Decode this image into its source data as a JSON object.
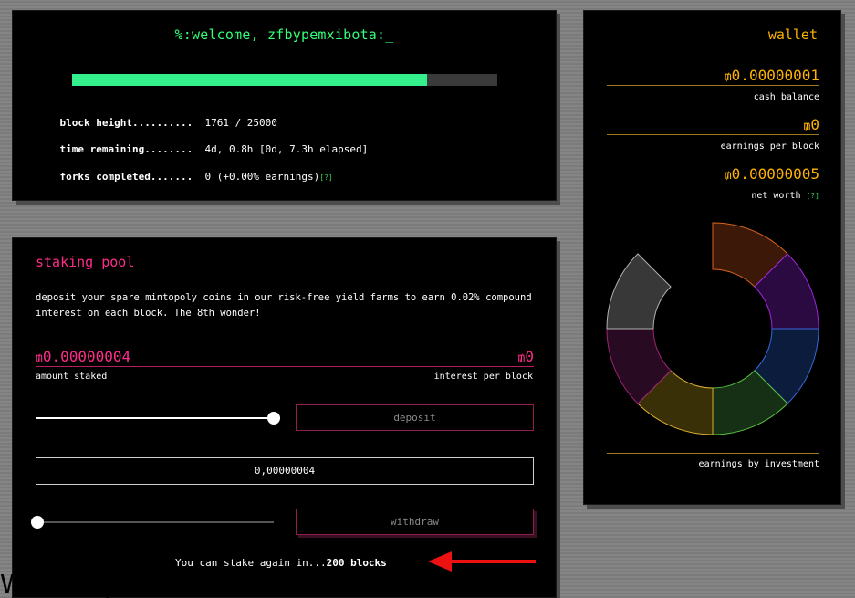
{
  "status": {
    "title": "%:welcome, zfbypemxibota:_",
    "progress_fraction": 0.835,
    "rows": [
      {
        "label": "block height..........",
        "value": "1761 / 25000",
        "help": ""
      },
      {
        "label": "time remaining........",
        "value": "4d, 0.8h [0d, 7.3h elapsed]",
        "help": ""
      },
      {
        "label": "forks completed.......",
        "value": "0 (+0.00% earnings)",
        "help": "[?]"
      }
    ]
  },
  "wallet": {
    "title": "wallet",
    "coin_symbol": "₥",
    "cash_balance_value": "0.00000001",
    "cash_balance_label": "cash balance",
    "earnings_value": "0",
    "earnings_label": "earnings per block",
    "networth_value": "0.00000005",
    "networth_label": "net worth",
    "networth_help": "[?]",
    "chart_label": "earnings by investment"
  },
  "chart_data": {
    "type": "pie",
    "title": "",
    "categories": [
      "",
      "",
      "",
      "",
      "",
      "",
      "",
      ""
    ],
    "values": [
      12.5,
      12.5,
      12.5,
      12.5,
      12.5,
      12.5,
      12.5,
      12.5
    ],
    "colors": [
      {
        "fill": "#3c1808",
        "stroke": "#d9641c"
      },
      {
        "fill": "#2a0a40",
        "stroke": "#9c28d8"
      },
      {
        "fill": "#0c1c3c",
        "stroke": "#3a68d8"
      },
      {
        "fill": "#163016",
        "stroke": "#58c040"
      },
      {
        "fill": "#3a3008",
        "stroke": "#d8b030"
      },
      {
        "fill": "#280a22",
        "stroke": "#9c2470"
      },
      {
        "fill": "#383838",
        "stroke": "#b0b0b0"
      }
    ],
    "start_angle_deg": 0,
    "slice_order_note": ""
  },
  "staking": {
    "title": "staking pool",
    "description": "deposit your spare mintopoly coins in our risk-free yield farms to earn 0.02% compound interest on each block. The 8th wonder!",
    "amount_value": "0.00000004",
    "amount_label": "amount staked",
    "interest_value": "0",
    "interest_label": "interest per block",
    "deposit_slider_fraction": 1.0,
    "deposit_label": "deposit",
    "input_value": "0,00000004",
    "withdraw_slider_fraction": 0.0,
    "withdraw_label": "withdraw",
    "notice_prefix": "You can stake again in...",
    "notice_bold": "200 blocks"
  },
  "overlay_text": "WebHarpina",
  "colors": {
    "status_green": "#33ff77",
    "wallet_gold": "#ffb300",
    "staking_pink": "#ff2d8a",
    "arrow_red": "#ee1111"
  }
}
